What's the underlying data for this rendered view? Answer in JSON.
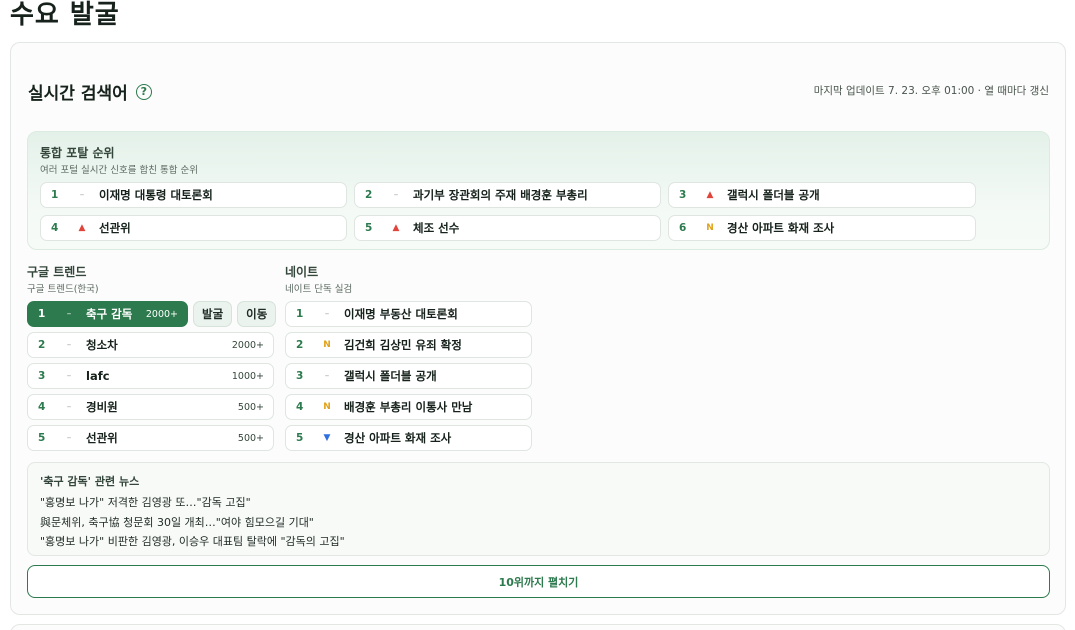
{
  "page": {
    "title": "수요 발굴"
  },
  "realtime": {
    "title": "실시간 검색어",
    "help_icon": "?",
    "last_update": "마지막 업데이트 7. 23. 오후 01:00 · 열 때마다 갱신"
  },
  "portal": {
    "title": "통합 포탈 순위",
    "subtitle": "여러 포털 실시간 신호를 합친 통합 순위",
    "items": [
      {
        "rank": "1",
        "mark": "–",
        "trend": "same",
        "keyword": "이재명 대통령 대토론회"
      },
      {
        "rank": "2",
        "mark": "–",
        "trend": "same",
        "keyword": "과기부 장관회의 주재 배경훈 부총리"
      },
      {
        "rank": "3",
        "mark": "▲",
        "trend": "up",
        "keyword": "갤럭시 폴더블 공개"
      },
      {
        "rank": "4",
        "mark": "▲",
        "trend": "up",
        "keyword": "선관위"
      },
      {
        "rank": "5",
        "mark": "▲",
        "trend": "up",
        "keyword": "체조 선수"
      },
      {
        "rank": "6",
        "mark": "N",
        "trend": "new",
        "keyword": "경산 아파트 화재 조사"
      }
    ]
  },
  "google": {
    "title": "구글 트렌드",
    "subtitle": "구글 트렌드(한국)",
    "items": [
      {
        "rank": "1",
        "mark": "–",
        "trend": "same",
        "keyword": "축구 감독",
        "count": "2000+"
      },
      {
        "rank": "2",
        "mark": "–",
        "trend": "same",
        "keyword": "청소차",
        "count": "2000+"
      },
      {
        "rank": "3",
        "mark": "–",
        "trend": "same",
        "keyword": "lafc",
        "count": "1000+"
      },
      {
        "rank": "4",
        "mark": "–",
        "trend": "same",
        "keyword": "경비원",
        "count": "500+"
      },
      {
        "rank": "5",
        "mark": "–",
        "trend": "same",
        "keyword": "선관위",
        "count": "500+"
      }
    ],
    "action_discover": "발굴",
    "action_move": "이동"
  },
  "nate": {
    "title": "네이트",
    "subtitle": "네이트 단독 실검",
    "items": [
      {
        "rank": "1",
        "mark": "–",
        "trend": "same",
        "keyword": "이재명 부동산 대토론회"
      },
      {
        "rank": "2",
        "mark": "N",
        "trend": "new",
        "keyword": "김건희 김상민 유죄 확정"
      },
      {
        "rank": "3",
        "mark": "–",
        "trend": "same",
        "keyword": "갤럭시 폴더블 공개"
      },
      {
        "rank": "4",
        "mark": "N",
        "trend": "new",
        "keyword": "배경훈 부총리 이통사 만남"
      },
      {
        "rank": "5",
        "mark": "▼",
        "trend": "down",
        "keyword": "경산 아파트 화재 조사"
      }
    ]
  },
  "news": {
    "title": "'축구 감독' 관련 뉴스",
    "items": [
      "\"홍명보 나가\" 저격한 김영광 또…\"감독 고집\"",
      "與문체위, 축구協 청문회 30일 개최…\"여야 힘모으길 기대\"",
      "\"홍명보 나가\" 비판한 김영광, 이승우 대표팀 탈락에 \"감독의 고집\""
    ]
  },
  "expand": {
    "label": "10위까지 펼치기"
  },
  "colors": {
    "accent": "#2c7a4d",
    "up": "#e0443a",
    "down": "#2f6fe0",
    "new": "#e0a21a"
  }
}
